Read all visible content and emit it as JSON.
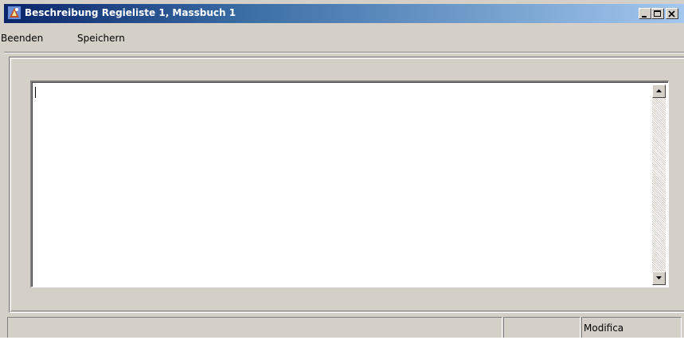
{
  "window": {
    "title": "Beschreibung Regieliste 1, Massbuch 1",
    "icon": "app-icon",
    "caption_buttons": [
      "minimize",
      "maximize",
      "close"
    ]
  },
  "menu": {
    "items": [
      {
        "label": "Beenden"
      },
      {
        "label": "Speichern"
      }
    ]
  },
  "editor": {
    "value": ""
  },
  "status": {
    "panels": [
      "",
      "",
      "Modifica"
    ]
  },
  "colors": {
    "face": "#d4d0c8",
    "title_start": "#0a246a",
    "title_end": "#a6caf0"
  }
}
